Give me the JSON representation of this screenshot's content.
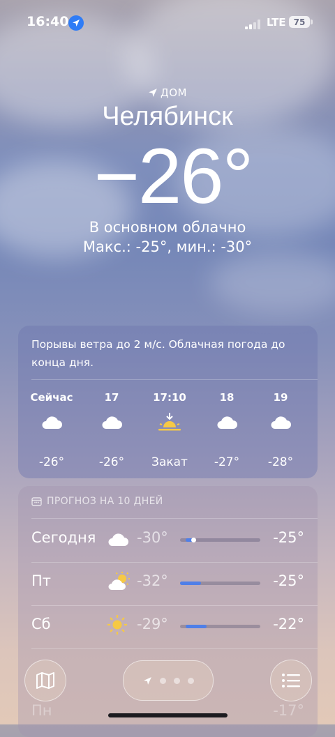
{
  "status": {
    "time": "16:40",
    "network": "LTE",
    "battery": "75"
  },
  "location": {
    "label": "ДОМ",
    "city": "Челябинск",
    "temperature": "−26°",
    "condition": "В основном облачно",
    "hilo": "Макс.: -25°, мин.: -30°"
  },
  "hourly": {
    "summary": "Порывы ветра до 2 м/с. Облачная погода до конца дня.",
    "items": [
      {
        "time": "Сейчас",
        "icon": "cloud-icon",
        "value": "-26°"
      },
      {
        "time": "17",
        "icon": "cloud-icon",
        "value": "-26°"
      },
      {
        "time": "17:10",
        "icon": "sunset-icon",
        "value": "Закат"
      },
      {
        "time": "18",
        "icon": "cloud-icon",
        "value": "-27°"
      },
      {
        "time": "19",
        "icon": "cloud-icon",
        "value": "-28°"
      }
    ]
  },
  "daily": {
    "title": "ПРОГНОЗ НА 10 ДНЕЙ",
    "days": [
      {
        "name": "Сегодня",
        "icon": "cloud-icon",
        "low": "-30°",
        "high": "-25°"
      },
      {
        "name": "Пт",
        "icon": "partly-sunny-icon",
        "low": "-32°",
        "high": "-25°"
      },
      {
        "name": "Сб",
        "icon": "sun-icon",
        "low": "-29°",
        "high": "-22°"
      }
    ],
    "partial_row_high": "-17°",
    "partial_row_name": "Пн"
  },
  "colors": {
    "accent_bar": "#4f7fe8",
    "location_badge": "#2f7cf6"
  }
}
